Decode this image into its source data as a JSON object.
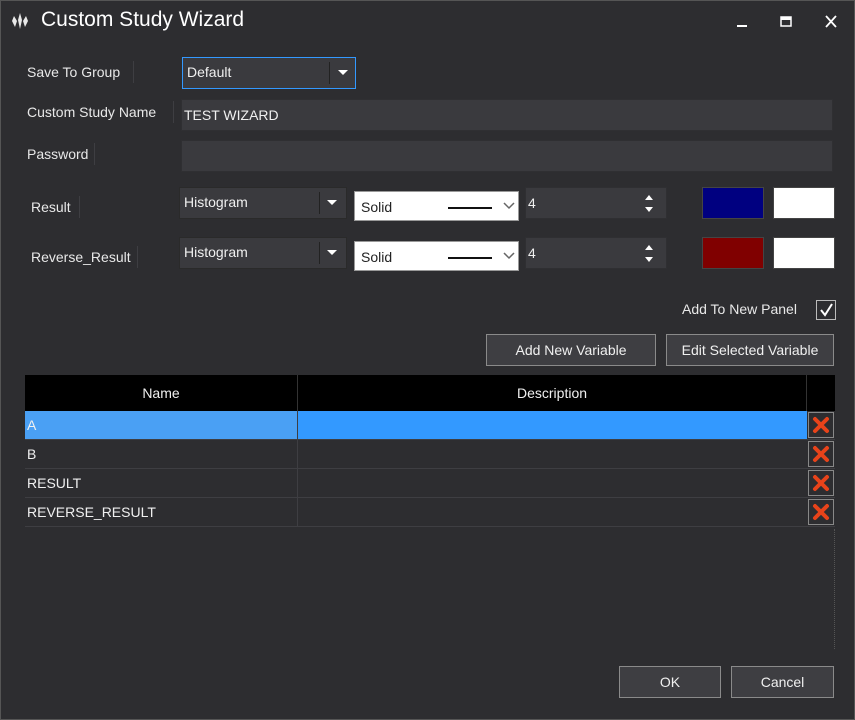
{
  "window": {
    "title": "Custom Study Wizard",
    "controls": [
      "minimize-icon",
      "maximize-icon",
      "close-icon"
    ]
  },
  "form": {
    "save_to_group_label": "Save To Group",
    "save_to_group_value": "Default",
    "study_name_label": "Custom Study Name",
    "study_name_value": "TEST WIZARD",
    "password_label": "Password",
    "password_value": ""
  },
  "outputs": [
    {
      "label": "Result",
      "type": "Histogram",
      "line_style": "Solid",
      "width": "4",
      "color_primary": "#000080",
      "color_secondary": "#ffffff"
    },
    {
      "label": "Reverse_Result",
      "type": "Histogram",
      "line_style": "Solid",
      "width": "4",
      "color_primary": "#800000",
      "color_secondary": "#ffffff"
    }
  ],
  "add_to_new_panel": {
    "label": "Add To New Panel",
    "checked": true
  },
  "buttons": {
    "add_variable": "Add New Variable",
    "edit_variable": "Edit Selected Variable",
    "ok": "OK",
    "cancel": "Cancel"
  },
  "variables": {
    "columns": [
      "Name",
      "Description"
    ],
    "rows": [
      {
        "name": "A",
        "description": "",
        "selected": true
      },
      {
        "name": "B",
        "description": "",
        "selected": false
      },
      {
        "name": "RESULT",
        "description": "",
        "selected": false
      },
      {
        "name": "REVERSE_RESULT",
        "description": "",
        "selected": false
      }
    ],
    "delete_icon": "delete-x-icon"
  },
  "colors": {
    "background": "#2d2d30",
    "selection": "#3399ff",
    "delete_icon": "#e8431a"
  }
}
